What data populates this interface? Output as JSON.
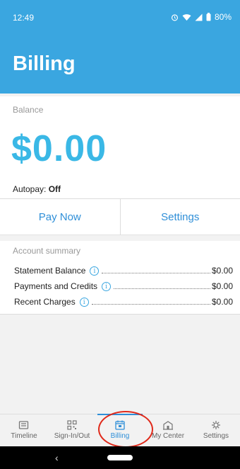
{
  "status_bar": {
    "time": "12:49",
    "battery": "80%"
  },
  "header": {
    "title": "Billing"
  },
  "balance": {
    "label": "Balance",
    "amount": "$0.00",
    "autopay_label": "Autopay:",
    "autopay_value": "Off"
  },
  "actions": {
    "pay_now": "Pay Now",
    "settings": "Settings"
  },
  "summary": {
    "title": "Account summary",
    "rows": [
      {
        "label": "Statement Balance",
        "value": "$0.00"
      },
      {
        "label": "Payments and Credits",
        "value": "$0.00"
      },
      {
        "label": "Recent Charges",
        "value": "$0.00"
      }
    ]
  },
  "nav": {
    "items": [
      {
        "label": "Timeline",
        "icon": "timeline-icon"
      },
      {
        "label": "Sign-In/Out",
        "icon": "qr-code-icon"
      },
      {
        "label": "Billing",
        "icon": "calendar-icon",
        "active": true
      },
      {
        "label": "My Center",
        "icon": "building-icon"
      },
      {
        "label": "Settings",
        "icon": "gear-icon"
      }
    ]
  },
  "colors": {
    "primary": "#3aa6e0",
    "amount": "#3ab8e6",
    "link": "#2f8fd8",
    "highlight": "#e02a1b"
  }
}
